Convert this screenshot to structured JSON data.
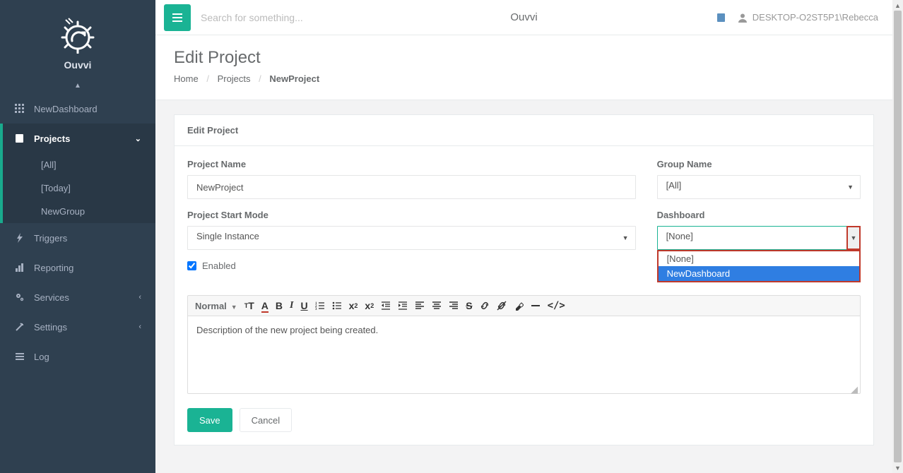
{
  "brand": {
    "name": "Ouvvi"
  },
  "topbar": {
    "search_placeholder": "Search for something...",
    "center_title": "Ouvvi",
    "user": "DESKTOP-O2ST5P1\\Rebecca"
  },
  "sidebar": {
    "items": [
      {
        "label": "NewDashboard"
      },
      {
        "label": "Projects"
      },
      {
        "label": "Triggers"
      },
      {
        "label": "Reporting"
      },
      {
        "label": "Services"
      },
      {
        "label": "Settings"
      },
      {
        "label": "Log"
      }
    ],
    "projects_sub": [
      {
        "label": "[All]"
      },
      {
        "label": "[Today]"
      },
      {
        "label": "NewGroup"
      }
    ]
  },
  "page": {
    "title": "Edit Project",
    "breadcrumb": {
      "home": "Home",
      "projects": "Projects",
      "current": "NewProject"
    },
    "panel_title": "Edit Project"
  },
  "form": {
    "project_name": {
      "label": "Project Name",
      "value": "NewProject"
    },
    "start_mode": {
      "label": "Project Start Mode",
      "value": "Single Instance"
    },
    "enabled": {
      "label": "Enabled",
      "checked": true
    },
    "group_name": {
      "label": "Group Name",
      "value": "[All]"
    },
    "dashboard": {
      "label": "Dashboard",
      "value": "[None]",
      "options": [
        "[None]",
        "NewDashboard"
      ],
      "highlight_index": 1
    },
    "description": {
      "value": "Description of the new project being created."
    }
  },
  "editor_toolbar": {
    "style_label": "Normal"
  },
  "actions": {
    "save": "Save",
    "cancel": "Cancel"
  },
  "colors": {
    "accent": "#1ab394",
    "highlight_border": "#c0392b",
    "dropdown_highlight": "#2f7ee2"
  }
}
